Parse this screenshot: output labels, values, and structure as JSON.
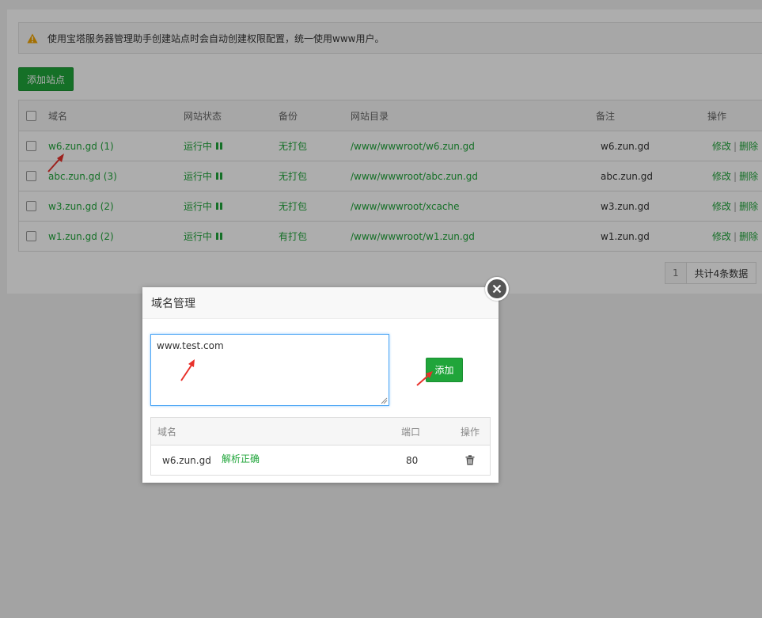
{
  "notice": {
    "icon": "warning-icon",
    "text": "使用宝塔服务器管理助手创建站点时会自动创建权限配置，统一使用www用户。"
  },
  "toolbar": {
    "add_site_label": "添加站点"
  },
  "site_table": {
    "headers": {
      "domain": "域名",
      "status": "网站状态",
      "backup": "备份",
      "root": "网站目录",
      "note": "备注",
      "ops": "操作"
    },
    "rows": [
      {
        "domain": "w6.zun.gd (1)",
        "status": "运行中",
        "backup": "无打包",
        "root": "/www/wwwroot/w6.zun.gd",
        "note": "w6.zun.gd",
        "edit": "修改",
        "delete": "删除"
      },
      {
        "domain": "abc.zun.gd (3)",
        "status": "运行中",
        "backup": "无打包",
        "root": "/www/wwwroot/abc.zun.gd",
        "note": "abc.zun.gd",
        "edit": "修改",
        "delete": "删除"
      },
      {
        "domain": "w3.zun.gd (2)",
        "status": "运行中",
        "backup": "无打包",
        "root": "/www/wwwroot/xcache",
        "note": "w3.zun.gd",
        "edit": "修改",
        "delete": "删除"
      },
      {
        "domain": "w1.zun.gd (2)",
        "status": "运行中",
        "backup": "有打包",
        "root": "/www/wwwroot/w1.zun.gd",
        "note": "w1.zun.gd",
        "edit": "修改",
        "delete": "删除"
      }
    ],
    "separator": "|"
  },
  "pagination": {
    "current_page": "1",
    "total_text": "共计4条数据"
  },
  "modal": {
    "title": "域名管理",
    "input_value": "www.test.com",
    "add_button_label": "添加",
    "table": {
      "headers": {
        "domain": "域名",
        "port": "端口",
        "ops": "操作"
      },
      "rows": [
        {
          "domain": "w6.zun.gd",
          "status": "解析正确",
          "port": "80"
        }
      ]
    }
  },
  "colors": {
    "accent_green": "#20a53a",
    "arrow_red": "#e8312b",
    "focus_blue": "#4fa7f5"
  }
}
